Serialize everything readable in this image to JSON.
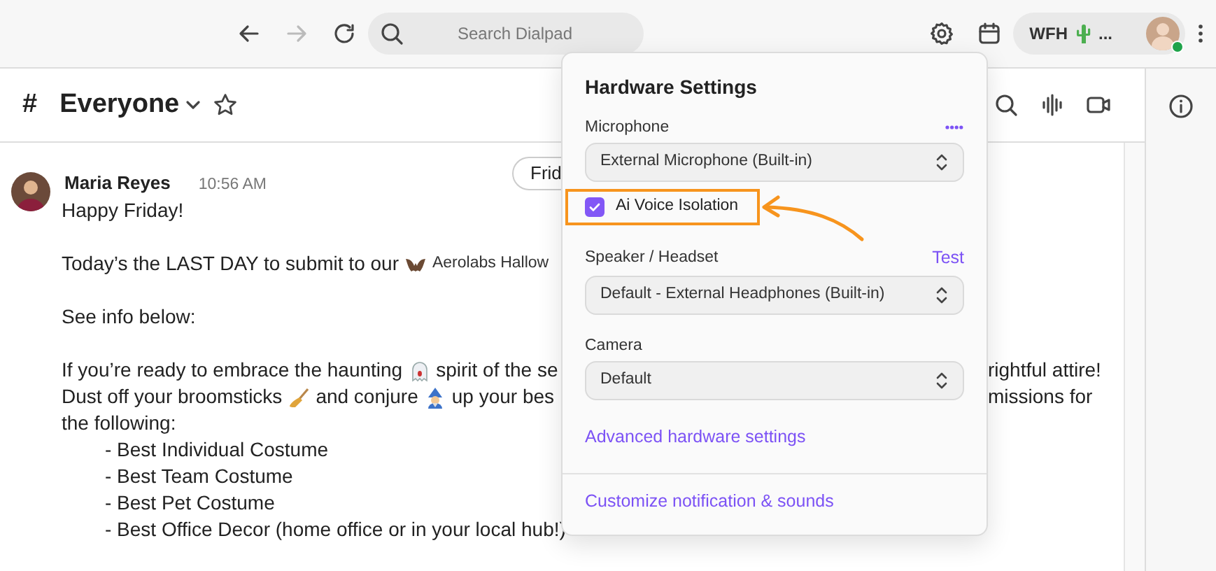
{
  "toolbar": {
    "forward": {
      "disabled": true
    },
    "search": {
      "placeholder": "Search Dialpad"
    },
    "status": {
      "text": "WFH",
      "more": "..."
    },
    "user": {
      "online": true
    }
  },
  "channel": {
    "hash": "#",
    "name": "Everyone",
    "starred": false
  },
  "date_pill": "Frid",
  "message": {
    "author": "Maria Reyes",
    "time": "10:56 AM",
    "paragraphs": [
      [
        {
          "segments": [
            {
              "kind": "text",
              "text": "Happy Friday!"
            }
          ]
        }
      ],
      [
        {
          "segments": [
            {
              "kind": "text",
              "text": "Today’s the LAST DAY to submit to our"
            },
            {
              "kind": "bat"
            },
            {
              "kind": "small",
              "text": "Aerolabs Hallow"
            }
          ]
        }
      ],
      [
        {
          "segments": [
            {
              "kind": "text",
              "text": "See info below:"
            }
          ]
        }
      ],
      [
        {
          "segments": [
            {
              "kind": "text",
              "text": "If you’re ready to embrace the haunting"
            },
            {
              "kind": "ghost"
            },
            {
              "kind": "text",
              "text": "spirit of the se"
            }
          ],
          "tail": "rightful attire!"
        },
        {
          "segments": [
            {
              "kind": "text",
              "text": "Dust off your broomsticks"
            },
            {
              "kind": "broom"
            },
            {
              "kind": "text",
              "text": "and conjure"
            },
            {
              "kind": "wizard"
            },
            {
              "kind": "text",
              "text": "up your bes"
            }
          ],
          "tail": "missions for"
        },
        {
          "segments": [
            {
              "kind": "text",
              "text": "the following:"
            }
          ]
        },
        {
          "indent": true,
          "segments": [
            {
              "kind": "text",
              "text": "- Best Individual Costume"
            }
          ]
        },
        {
          "indent": true,
          "segments": [
            {
              "kind": "text",
              "text": "- Best Team Costume"
            }
          ]
        },
        {
          "indent": true,
          "segments": [
            {
              "kind": "text",
              "text": "- Best Pet Costume"
            }
          ]
        },
        {
          "indent": true,
          "segments": [
            {
              "kind": "text",
              "text": "- Best Office Decor (home office or in your local hub!)"
            }
          ]
        }
      ]
    ]
  },
  "hardware_settings": {
    "title": "Hardware Settings",
    "items": [
      {
        "kind": "select",
        "label": "Microphone",
        "meter": true,
        "value": "External Microphone (Built-in)"
      },
      {
        "kind": "checkbox",
        "label": "Ai Voice Isolation",
        "checked": true,
        "highlighted": true
      },
      {
        "kind": "select",
        "label": "Speaker / Headset",
        "action": "Test",
        "value": "Default - External Headphones (Built-in)"
      },
      {
        "kind": "select",
        "label": "Camera",
        "value": "Default"
      },
      {
        "kind": "link",
        "label": "Advanced hardware settings"
      },
      {
        "kind": "link",
        "label": "Customize notification & sounds",
        "divider_before": true
      }
    ]
  }
}
